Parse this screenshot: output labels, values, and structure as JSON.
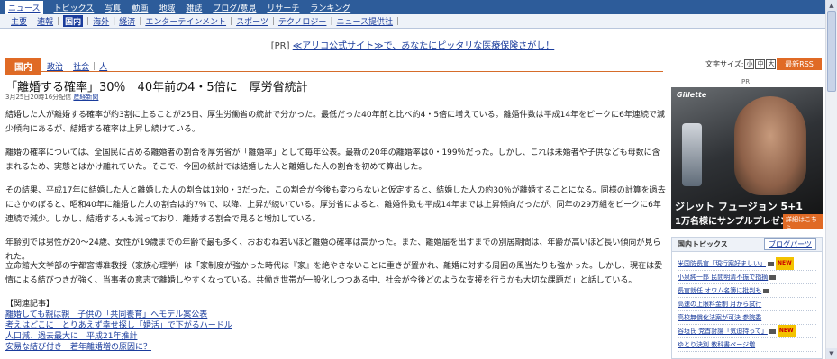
{
  "topnav": [
    {
      "label": "ニュース",
      "active": true
    },
    {
      "label": "トピックス"
    },
    {
      "label": "写真"
    },
    {
      "label": "動画"
    },
    {
      "label": "地域"
    },
    {
      "label": "雑誌"
    },
    {
      "label": "ブログ/意見"
    },
    {
      "label": "リサーチ"
    },
    {
      "label": "ランキング"
    }
  ],
  "subnav": [
    {
      "label": "主要"
    },
    {
      "label": "速報"
    },
    {
      "label": "国内",
      "active": true
    },
    {
      "label": "海外"
    },
    {
      "label": "経済"
    },
    {
      "label": "エンターテインメント"
    },
    {
      "label": "スポーツ"
    },
    {
      "label": "テクノロジー"
    },
    {
      "label": "ニュース提供社"
    }
  ],
  "pr": {
    "label": "[PR]",
    "link": "≪アリコ公式サイト≫で、あなたにピッタリな医療保険さがし！"
  },
  "category": {
    "badge": "国内",
    "links": [
      "政治",
      "社会",
      "人"
    ]
  },
  "font_size": {
    "label": "文字サイズ:",
    "small": "小",
    "medium": "中",
    "large": "大"
  },
  "rss_label": "最新RSS",
  "article": {
    "title": "「離婚する確率」30％　40年前の4・5倍に　厚労省統計",
    "date": "3月25日20時16分配信",
    "source": "産経新聞",
    "paragraphs": [
      "結婚した人が離婚する確率が約3割に上ることが25日、厚生労働省の統計で分かった。最低だった40年前と比べ約4・5倍に増えている。離婚件数は平成14年をピークに6年連続で減少傾向にあるが、結婚する確率は上昇し続けている。",
      "離婚の確率については、全国民に占める離婚者の割合を厚労省が「離婚率」として毎年公表。最新の20年の離婚率は0・199％だった。しかし、これは未婚者や子供なども母数に含まれるため、実態とはかけ離れていた。そこで、今回の統計では結婚した人と離婚した人の割合を初めて算出した。",
      "その結果、平成17年に結婚した人と離婚した人の割合は1対0・3だった。この割合が今後も変わらないと仮定すると、結婚した人の約30％が離婚することになる。同様の計算を過去にさかのぼると、昭和40年に離婚した人の割合は約7％で、以降、上昇が続いている。厚労省によると、離婚件数も平成14年までは上昇傾向だったが、同年の29万組をピークに6年連続で減少。しかし、結婚する人も減っており、離婚する割合で見ると増加している。",
      "年齢別では男性が20～24歳、女性が19歳までの年齢で最も多く、おおむね若いほど離婚の確率は高かった。また、離婚届を出すまでの別居期間は、年齢が高いほど長い傾向が見られた。",
      "立命館大文学部の宇都宮博准教授（家族心理学）は「家制度が強かった時代は『家』を絶やさないことに重きが置かれ、離婚に対する周囲の風当たりも強かった。しかし、現在は愛情による結びつきが強く、当事者の意志で離婚しやすくなっている。共働き世帯が一般化しつつある中、社会が今後どのような支援を行うかも大切な課題だ」と話している。"
    ],
    "related_heading": "【関連記事】",
    "related": [
      "離婚しても親は親　子供の「共同養育」へモデル案公表",
      "考えはどこに　とりあえず幸せ探し「婚活」で下がるハードル",
      "人口減、過去最大に　平成21年推計",
      "安易な結び付き　若年離婚増の原因に？"
    ]
  },
  "sidebar": {
    "pr_label": "PR",
    "ad": {
      "brand": "Gillette",
      "copy1": "ジレット フュージョン 5+1",
      "copy2": "1万名様にサンプルプレゼント",
      "button": "詳細はこちら"
    },
    "topics": {
      "heading": "国内トピックス",
      "blog_link": "ブログパーツ",
      "items": [
        {
          "text": "米国防長官「現行案好ましい」",
          "camera": true,
          "new": true
        },
        {
          "text": "小泉純一郎 民間明清不振で指摘",
          "camera": true,
          "new": false
        },
        {
          "text": "長官就任 オウム名簿に批判も",
          "camera": true,
          "new": false
        },
        {
          "text": "高速の上限料金制 月から試行",
          "camera": false,
          "new": false
        },
        {
          "text": "高校無償化法案が可決 参院委",
          "camera": false,
          "new": false
        },
        {
          "text": "谷垣氏 党首討論「気迫持って」",
          "camera": true,
          "new": true
        },
        {
          "text": "ゆとり決別 教科書ページ増",
          "camera": false,
          "new": false
        }
      ]
    }
  }
}
